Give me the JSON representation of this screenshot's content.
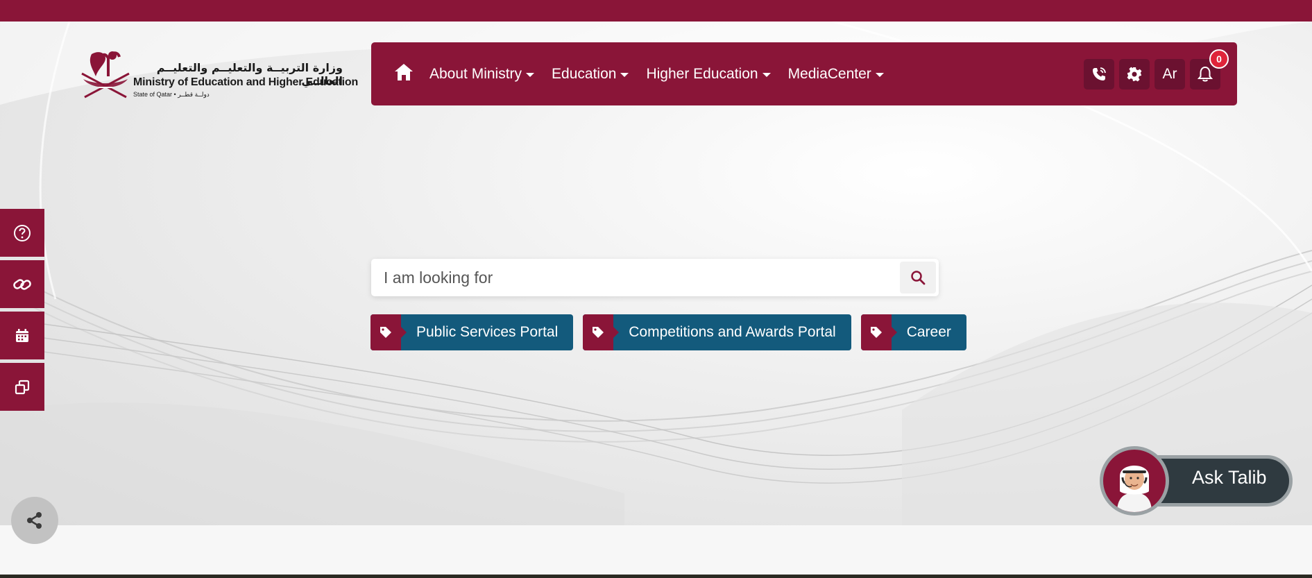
{
  "colors": {
    "brand": "#8a1538",
    "brand_dark": "#6b1130",
    "quick_link": "#135a7c",
    "badge": "#e0243a",
    "ask_pill": "#2f3a40"
  },
  "logo": {
    "arabic_title": "وزارة التربيــة والتعليــم والتعليــم العالــي",
    "english_title": "Ministry of Education and Higher Education",
    "state_line": "State of Qatar • دولــة قطــر"
  },
  "nav": {
    "home_icon": "home-icon",
    "items": [
      {
        "label": "About Ministry"
      },
      {
        "label": "Education"
      },
      {
        "label": "Higher Education"
      },
      {
        "label": "MediaCenter"
      }
    ],
    "tools": {
      "contact_icon": "phone-call-icon",
      "settings_icon": "gear-icon",
      "language_label": "Ar",
      "notifications_icon": "bell-icon",
      "notifications_count": "0"
    }
  },
  "side_buttons": [
    {
      "icon": "help-circle-icon"
    },
    {
      "icon": "link-icon"
    },
    {
      "icon": "calendar-icon"
    },
    {
      "icon": "windows-icon"
    }
  ],
  "search": {
    "placeholder": "I am looking for",
    "icon": "search-icon"
  },
  "quick_links": [
    {
      "label": "Public Services Portal",
      "icon": "tag-icon"
    },
    {
      "label": "Competitions and Awards Portal",
      "icon": "tag-icon"
    },
    {
      "label": "Career",
      "icon": "tag-icon"
    }
  ],
  "share": {
    "icon": "share-icon"
  },
  "ask_talib": {
    "label": "Ask Talib"
  }
}
